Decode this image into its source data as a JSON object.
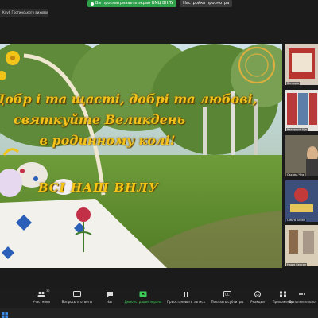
{
  "share_bar": {
    "sharing_text": "Вы просматриваете экран ВМЦ ВНЛУ",
    "view_options": "Настройки просмотра"
  },
  "meeting_title": "Клуб Гостинського виховання",
  "slide": {
    "line1": "Добр і та щасті, добрі та любові,",
    "line2": "святкуйте Великдень",
    "line3": "в родинному колі!",
    "signature": "ВСІ НАШ ВНЛУ"
  },
  "participants": [
    {
      "name": "Вікторія"
    },
    {
      "name": "Катерина Ща"
    },
    {
      "name": "Оксана Чуж"
    },
    {
      "name": "Ольга Тихон"
    },
    {
      "name": "Надія Бессон"
    }
  ],
  "toolbar": {
    "participants": "Участники",
    "participants_count": "30",
    "qa": "Вопросы и ответы",
    "chat": "Чат",
    "share": "Демонстрация экрана",
    "record": "Приостановить запись",
    "captions": "Показать субтитры",
    "reactions": "Реакции",
    "apps": "Приложения",
    "more": "Дополнительно"
  },
  "colors": {
    "accent_green": "#2fa14a",
    "greeting_gold": "#f2c21a",
    "background": "#1b1b1b"
  }
}
